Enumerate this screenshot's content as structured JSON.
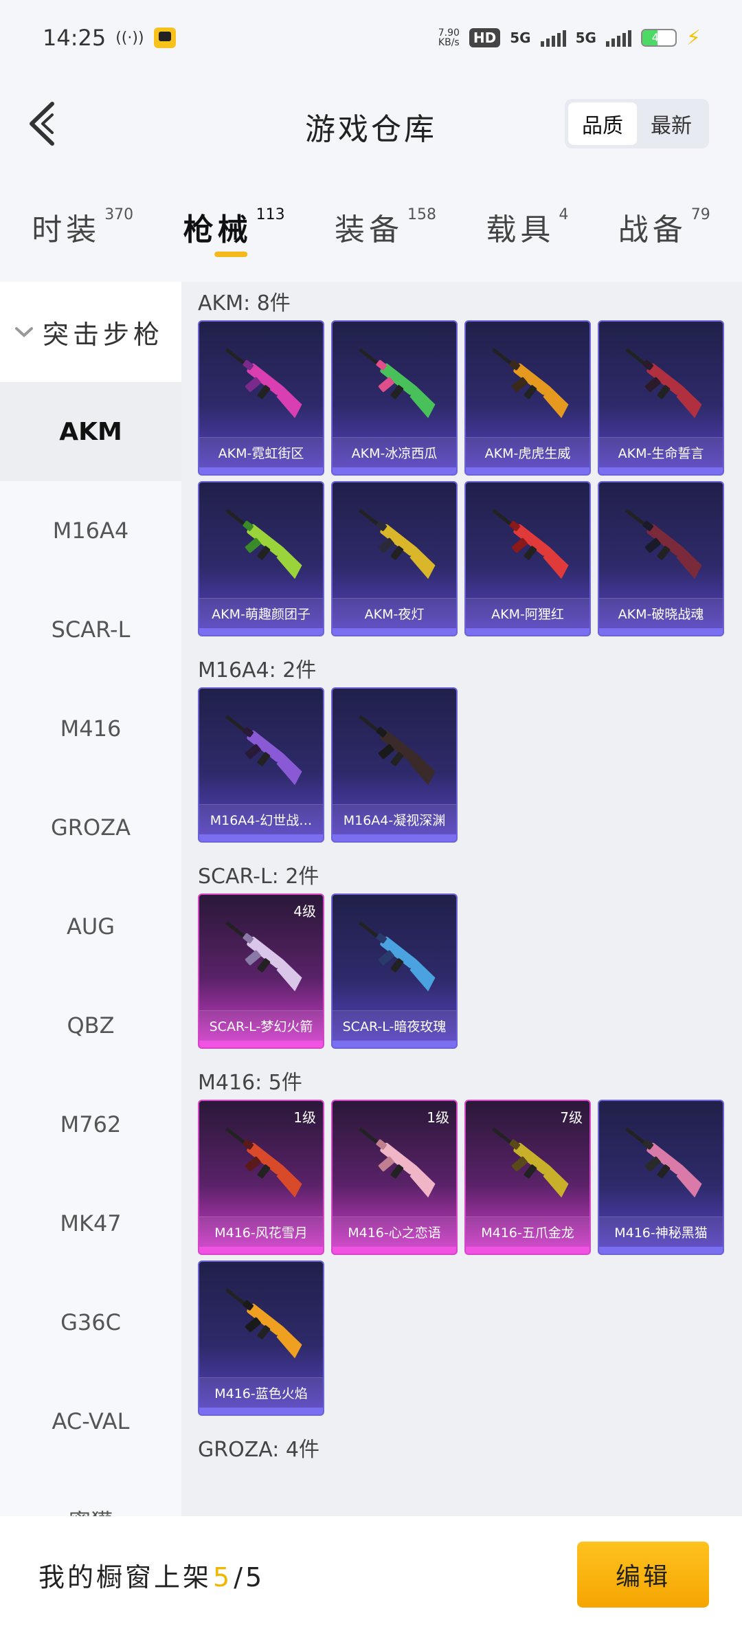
{
  "status_bar": {
    "time": "14:25",
    "net_speed_value": "7.90",
    "net_speed_unit": "KB/s",
    "hd": "HD",
    "sim1": "5G",
    "sim2": "5G",
    "battery": "46"
  },
  "header": {
    "title": "游戏仓库",
    "sort_options": [
      "品质",
      "最新"
    ]
  },
  "tabs": [
    {
      "label": "时装",
      "count": "370"
    },
    {
      "label": "枪械",
      "count": "113"
    },
    {
      "label": "装备",
      "count": "158"
    },
    {
      "label": "载具",
      "count": "4"
    },
    {
      "label": "战备",
      "count": "79"
    }
  ],
  "sidebar": {
    "group": "突击步枪",
    "items": [
      "AKM",
      "M16A4",
      "SCAR-L",
      "M416",
      "GROZA",
      "AUG",
      "QBZ",
      "M762",
      "MK47",
      "G36C",
      "AC-VAL",
      "蜜獾"
    ]
  },
  "sections": [
    {
      "title": "AKM: 8件",
      "items": [
        {
          "name": "AKM-霓虹街区",
          "level": "",
          "tier": "purple",
          "colors": [
            "#d93fb0",
            "#7a2a8a"
          ]
        },
        {
          "name": "AKM-冰凉西瓜",
          "level": "",
          "tier": "purple",
          "colors": [
            "#49c15a",
            "#e04f8c"
          ]
        },
        {
          "name": "AKM-虎虎生威",
          "level": "",
          "tier": "purple",
          "colors": [
            "#e59a1f",
            "#3a2a1a"
          ]
        },
        {
          "name": "AKM-生命誓言",
          "level": "",
          "tier": "purple",
          "colors": [
            "#b03040",
            "#2a1a2a"
          ]
        },
        {
          "name": "AKM-萌趣颜团子",
          "level": "",
          "tier": "purple",
          "colors": [
            "#9bd43a",
            "#3a8a2a"
          ]
        },
        {
          "name": "AKM-夜灯",
          "level": "",
          "tier": "purple",
          "colors": [
            "#d9b62a",
            "#2a2a3a"
          ]
        },
        {
          "name": "AKM-阿狸红",
          "level": "",
          "tier": "purple",
          "colors": [
            "#e03a3a",
            "#8a1a1a"
          ]
        },
        {
          "name": "AKM-破晓战魂",
          "level": "",
          "tier": "purple",
          "colors": [
            "#7a2a3a",
            "#1a1a2a"
          ]
        }
      ]
    },
    {
      "title": "M16A4: 2件",
      "items": [
        {
          "name": "M16A4-幻世战…",
          "level": "",
          "tier": "purple",
          "colors": [
            "#8a5ad6",
            "#2a1a3a"
          ]
        },
        {
          "name": "M16A4-凝视深渊",
          "level": "",
          "tier": "purple",
          "colors": [
            "#3a2a2a",
            "#1a1a1a"
          ]
        }
      ]
    },
    {
      "title": "SCAR-L: 2件",
      "items": [
        {
          "name": "SCAR-L-梦幻火箭",
          "level": "4级",
          "tier": "pink",
          "colors": [
            "#d9c6e8",
            "#8a7aa8"
          ]
        },
        {
          "name": "SCAR-L-暗夜玫瑰",
          "level": "",
          "tier": "purple",
          "colors": [
            "#4aa3e0",
            "#2a3a6a"
          ]
        }
      ]
    },
    {
      "title": "M416: 5件",
      "items": [
        {
          "name": "M416-风花雪月",
          "level": "1级",
          "tier": "pink",
          "colors": [
            "#d94a2a",
            "#5a1a1a"
          ]
        },
        {
          "name": "M416-心之恋语",
          "level": "1级",
          "tier": "pink",
          "colors": [
            "#f0b6c8",
            "#c08090"
          ]
        },
        {
          "name": "M416-五爪金龙",
          "level": "7级",
          "tier": "pink",
          "colors": [
            "#c8b02a",
            "#5a4a1a"
          ]
        },
        {
          "name": "M416-神秘黑猫",
          "level": "",
          "tier": "purple",
          "colors": [
            "#d97aa8",
            "#2a2a2a"
          ]
        },
        {
          "name": "M416-蓝色火焰",
          "level": "",
          "tier": "purple",
          "colors": [
            "#f0a020",
            "#1a1a1a"
          ]
        }
      ]
    },
    {
      "title": "GROZA: 4件",
      "items": []
    }
  ],
  "bottom": {
    "showcase_label": "我的橱窗上架",
    "showcase_current": "5",
    "showcase_sep_total": "/5",
    "edit_label": "编辑"
  },
  "colors": {
    "accent": "#f5b91c",
    "purple_card": "#5a44c7",
    "pink_card": "#d63fcf"
  }
}
